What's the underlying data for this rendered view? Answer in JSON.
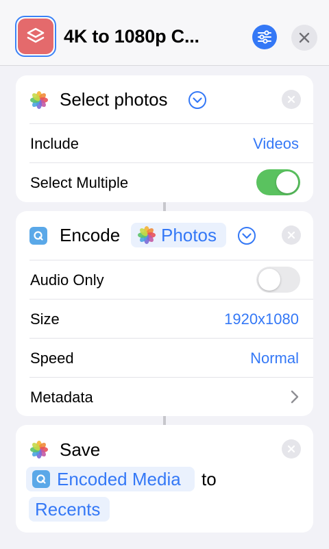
{
  "header": {
    "title": "4K to 1080p C...",
    "app_icon": "shortcuts-layers-icon",
    "settings_icon": "sliders-icon",
    "close_icon": "close-icon"
  },
  "cards": {
    "select_photos": {
      "title": "Select photos",
      "rows": [
        {
          "label": "Include",
          "value": "Videos"
        },
        {
          "label": "Select Multiple",
          "toggle": true
        }
      ]
    },
    "encode": {
      "title": "Encode",
      "input_token": "Photos",
      "rows": [
        {
          "label": "Audio Only",
          "toggle": false
        },
        {
          "label": "Size",
          "value": "1920x1080"
        },
        {
          "label": "Speed",
          "value": "Normal"
        },
        {
          "label": "Metadata"
        }
      ]
    },
    "save": {
      "title": "Save",
      "input_token": "Encoded Media",
      "connector_word": "to",
      "destination_token": "Recents"
    }
  },
  "colors": {
    "accent": "#3478f6",
    "toggle_on": "#5ac25f",
    "app_icon_bg": "#e46a6c"
  }
}
